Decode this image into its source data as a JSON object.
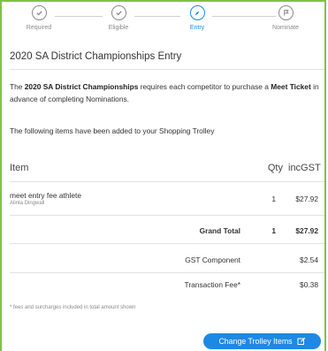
{
  "steps": [
    {
      "label": "Required",
      "state": "done",
      "icon": "check-circle-icon"
    },
    {
      "label": "Eligible",
      "state": "done",
      "icon": "check-circle-icon"
    },
    {
      "label": "Entry",
      "state": "active",
      "icon": "compass-icon"
    },
    {
      "label": "Nominate",
      "state": "pending",
      "icon": "flag-circle-icon"
    }
  ],
  "page": {
    "title": "2020 SA District Championships Entry",
    "intro_pre": "The ",
    "intro_bold1": "2020 SA District Championships",
    "intro_mid": " requires each competitor to purchase a ",
    "intro_bold2": "Meet Ticket",
    "intro_post": " in advance of completing Nominations.",
    "added_text": "The following items have been added to your Shopping Trolley"
  },
  "table": {
    "headers": {
      "item": "Item",
      "qty": "Qty",
      "price": "incGST"
    },
    "items": [
      {
        "name": "meet entry fee athlete",
        "athlete": "Alinta Dingwall",
        "qty": "1",
        "price": "$27.92"
      }
    ],
    "grand_total": {
      "label": "Grand Total",
      "qty": "1",
      "price": "$27.92"
    },
    "gst": {
      "label": "GST Component",
      "price": "$2.54"
    },
    "fee": {
      "label": "Transaction Fee*",
      "price": "$0.38"
    }
  },
  "footnote": "* fees and surcharges included in total amount shown",
  "button": {
    "label": "Change Trolley Items",
    "icon": "edit-icon"
  },
  "colors": {
    "accent": "#1e88e5",
    "border": "#7fc242",
    "muted": "#8a8a8a"
  }
}
